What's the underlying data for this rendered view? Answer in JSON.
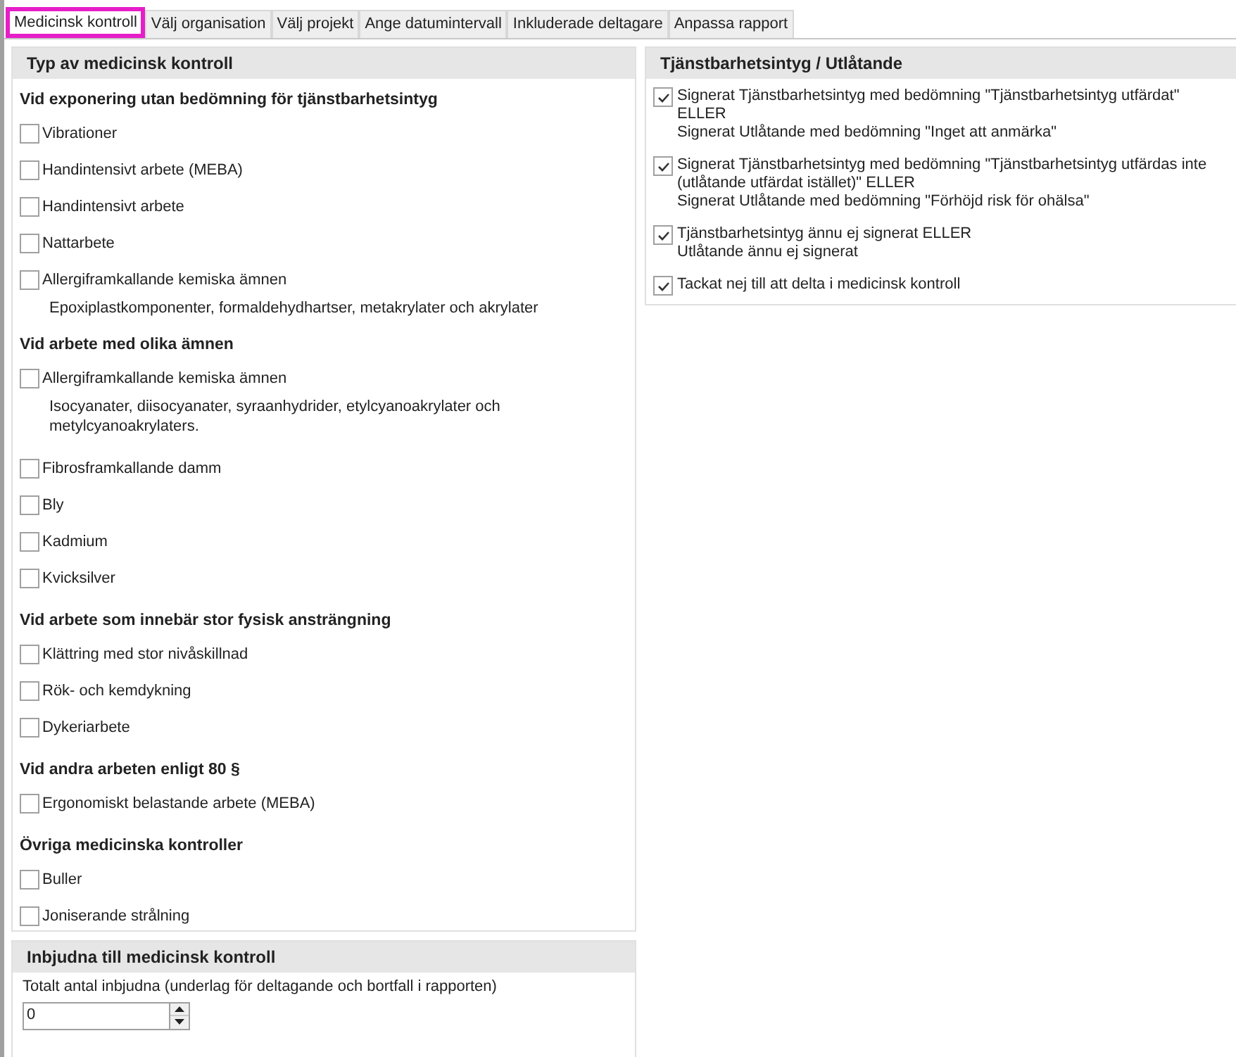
{
  "tabs": [
    {
      "label": "Medicinsk kontroll",
      "selected": true
    },
    {
      "label": "Välj organisation",
      "selected": false
    },
    {
      "label": "Välj projekt",
      "selected": false
    },
    {
      "label": "Ange datumintervall",
      "selected": false
    },
    {
      "label": "Inkluderade deltagare",
      "selected": false
    },
    {
      "label": "Anpassa rapport",
      "selected": false
    }
  ],
  "control_type_panel": {
    "title": "Typ av medicinsk kontroll",
    "groups": [
      {
        "heading": "Vid exponering utan bedömning för tjänstbarhetsintyg",
        "items": [
          {
            "kind": "checkbox",
            "label": "Vibrationer",
            "checked": false
          },
          {
            "kind": "checkbox",
            "label": "Handintensivt arbete (MEBA)",
            "checked": false
          },
          {
            "kind": "checkbox",
            "label": "Handintensivt arbete",
            "checked": false
          },
          {
            "kind": "checkbox",
            "label": "Nattarbete",
            "checked": false
          },
          {
            "kind": "checkbox",
            "label": "Allergiframkallande kemiska ämnen",
            "checked": false
          },
          {
            "kind": "note",
            "label": "Epoxiplastkomponenter, formaldehydhartser, metakrylater och akrylater"
          }
        ]
      },
      {
        "heading": "Vid arbete med olika ämnen",
        "items": [
          {
            "kind": "checkbox",
            "label": "Allergiframkallande kemiska ämnen",
            "checked": false
          },
          {
            "kind": "note",
            "label": "Isocyanater, diisocyanater, syraanhydrider, etylcyanoakrylater och metylcyanoakrylaters."
          },
          {
            "kind": "checkbox",
            "label": "Fibrosframkallande damm",
            "checked": false
          },
          {
            "kind": "checkbox",
            "label": "Bly",
            "checked": false
          },
          {
            "kind": "checkbox",
            "label": "Kadmium",
            "checked": false
          },
          {
            "kind": "checkbox",
            "label": "Kvicksilver",
            "checked": false
          }
        ]
      },
      {
        "heading": "Vid arbete som innebär stor fysisk ansträngning",
        "items": [
          {
            "kind": "checkbox",
            "label": "Klättring med stor nivåskillnad",
            "checked": false
          },
          {
            "kind": "checkbox",
            "label": "Rök- och kemdykning",
            "checked": false
          },
          {
            "kind": "checkbox",
            "label": "Dykeriarbete",
            "checked": false
          }
        ]
      },
      {
        "heading": "Vid andra arbeten enligt 80 §",
        "items": [
          {
            "kind": "checkbox",
            "label": "Ergonomiskt belastande arbete (MEBA)",
            "checked": false
          }
        ]
      },
      {
        "heading": "Övriga medicinska kontroller",
        "items": [
          {
            "kind": "checkbox",
            "label": "Buller",
            "checked": false
          },
          {
            "kind": "checkbox",
            "label": "Joniserande strålning",
            "checked": false
          }
        ]
      }
    ]
  },
  "invited_panel": {
    "title": "Inbjudna till medicinsk kontroll",
    "field_label": "Totalt antal inbjudna (underlag för deltagande och bortfall i rapporten)",
    "value": "0"
  },
  "certificate_panel": {
    "title": "Tjänstbarhetsintyg / Utlåtande",
    "items": [
      {
        "lines": [
          "Signerat Tjänstbarhetsintyg med bedömning \"Tjänstbarhetsintyg utfärdat\" ELLER",
          "Signerat Utlåtande med bedömning \"Inget att anmärka\""
        ],
        "checked": true
      },
      {
        "lines": [
          "Signerat Tjänstbarhetsintyg med bedömning \"Tjänstbarhetsintyg utfärdas inte (utlåtande utfärdat istället)\" ELLER",
          "Signerat Utlåtande med bedömning \"Förhöjd risk för ohälsa\""
        ],
        "checked": true
      },
      {
        "lines": [
          "Tjänstbarhetsintyg ännu ej signerat ELLER",
          "Utlåtande ännu ej signerat"
        ],
        "checked": true
      },
      {
        "lines": [
          "Tackat nej till att delta i medicinsk kontroll"
        ],
        "checked": true
      }
    ]
  }
}
